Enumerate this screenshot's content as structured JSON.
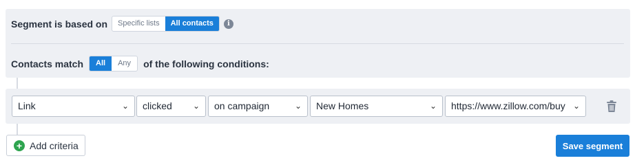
{
  "segment_basis": {
    "label": "Segment is based on",
    "options": [
      "Specific lists",
      "All contacts"
    ],
    "selected": "All contacts",
    "info_icon": "info-icon"
  },
  "match": {
    "prefix": "Contacts match",
    "options": [
      "All",
      "Any"
    ],
    "selected": "All",
    "suffix": "of the following conditions:"
  },
  "condition": {
    "field": "Link",
    "action": "clicked",
    "scope": "on campaign",
    "campaign": "New Homes",
    "url": "https://www.zillow.com/buy",
    "delete_icon": "trash-icon"
  },
  "actions": {
    "add_criteria": "Add criteria",
    "save_segment": "Save segment"
  },
  "colors": {
    "accent": "#1a7fd9",
    "add_icon": "#2ea44f",
    "panel": "#eef0f4"
  }
}
